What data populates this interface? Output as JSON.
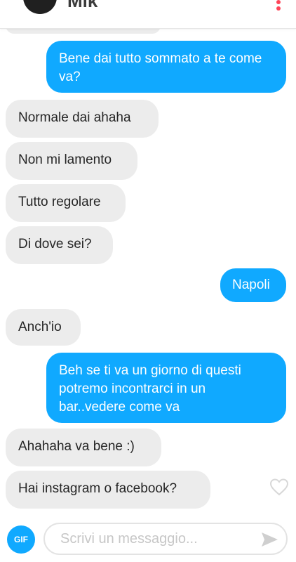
{
  "header": {
    "contact_name": "Mik",
    "menu_icon": "more-vertical-icon",
    "accent_color": "#ff4458"
  },
  "messages": [
    {
      "direction": "out",
      "text": "Bene dai tutto sommato a te come va?"
    },
    {
      "direction": "in",
      "text": "Normale dai ahaha"
    },
    {
      "direction": "in",
      "text": "Non mi lamento"
    },
    {
      "direction": "in",
      "text": "Tutto regolare"
    },
    {
      "direction": "in",
      "text": "Di dove sei?"
    },
    {
      "direction": "out",
      "text": "Napoli"
    },
    {
      "direction": "in",
      "text": "Anch'io"
    },
    {
      "direction": "out",
      "text": "Beh se ti va un giorno di questi potremo incontrarci in un bar..vedere come va"
    },
    {
      "direction": "in",
      "text": "Ahahaha va bene :)"
    },
    {
      "direction": "in",
      "text": "Hai instagram o facebook?"
    }
  ],
  "composer": {
    "gif_label": "GIF",
    "placeholder": "Scrivi un messaggio...",
    "send_icon": "send-icon"
  },
  "colors": {
    "outgoing_bubble": "#10a9ff",
    "incoming_bubble": "#ececec"
  }
}
